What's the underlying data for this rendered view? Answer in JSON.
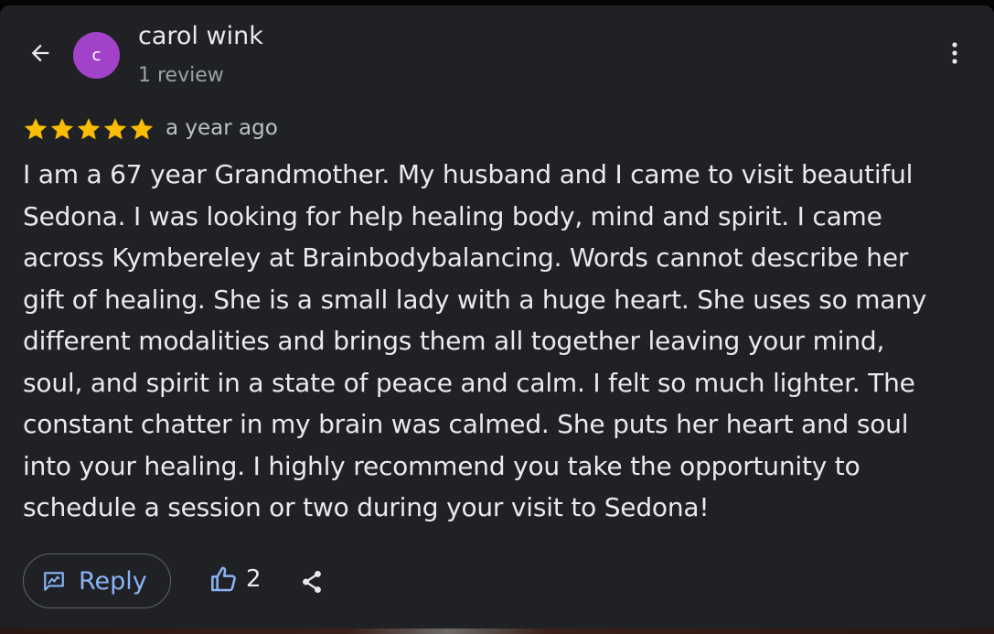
{
  "header": {
    "avatar_initial": "c",
    "avatar_color": "#a142c8",
    "reviewer_name": "carol wink",
    "review_count": "1 review",
    "back_icon": "arrow-back-icon",
    "menu_icon": "more-vert-icon"
  },
  "review": {
    "rating": 5,
    "rating_max": 5,
    "star_color": "#fbbc04",
    "timestamp": "a year ago",
    "text": "I am a 67 year Grandmother.  My husband and I came to visit beautiful\nSedona.  I was looking for help healing body, mind and spirit.  I came\nacross Kymbereley at Brainbodybalancing.  Words cannot describe her\ngift of healing.  She is a small lady with a huge heart.  She uses so many\ndifferent modalities and brings them all together leaving your mind,\nsoul, and spirit in a state of peace and calm.  I felt so much lighter.  The\nconstant chatter in my brain was calmed.  She puts her heart and soul\ninto your healing. I highly recommend you take the opportunity to\nschedule a session or two during your visit to Sedona!"
  },
  "actions": {
    "reply_label": "Reply",
    "reply_icon": "reply-icon",
    "like_count": "2",
    "like_icon": "thumb-up-icon",
    "share_icon": "share-icon",
    "accent_color": "#8ab4f8"
  }
}
